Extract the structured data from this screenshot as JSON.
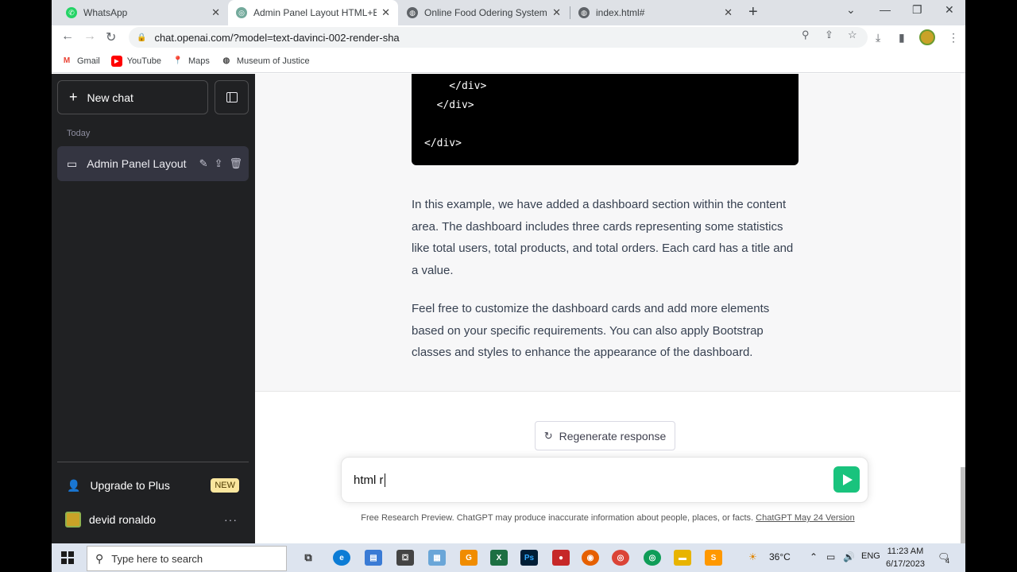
{
  "browser": {
    "tabs": [
      {
        "title": "WhatsApp",
        "icon": "whatsapp-icon",
        "color": "#25d366"
      },
      {
        "title": "Admin Panel Layout HTML+Boot",
        "icon": "openai-icon",
        "color": "#74aa9c"
      },
      {
        "title": "Online Food Odering System",
        "icon": "globe-icon",
        "color": "#5f6368"
      },
      {
        "title": "index.html#",
        "icon": "globe-icon",
        "color": "#5f6368"
      }
    ],
    "url": "chat.openai.com/?model=text-davinci-002-render-sha",
    "bookmarks": [
      {
        "label": "Gmail",
        "icon": "gmail-icon"
      },
      {
        "label": "YouTube",
        "icon": "youtube-icon"
      },
      {
        "label": "Maps",
        "icon": "maps-icon"
      },
      {
        "label": "Museum of Justice",
        "icon": "globe-icon"
      }
    ]
  },
  "sidebar": {
    "new_chat": "New chat",
    "section": "Today",
    "conversation": "Admin Panel Layout",
    "upgrade": "Upgrade to Plus",
    "badge": "NEW",
    "user": "devid ronaldo"
  },
  "main": {
    "code_lines": [
      "    </div>",
      "  </div>",
      "",
      "</div>"
    ],
    "paragraphs": [
      "In this example, we have added a dashboard section within the content area. The dashboard includes three cards representing some statistics like total users, total products, and total orders. Each card has a title and a value.",
      "Feel free to customize the dashboard cards and add more elements based on your specific requirements. You can also apply Bootstrap classes and styles to enhance the appearance of the dashboard."
    ],
    "regenerate": "Regenerate response",
    "input_value": "html r",
    "footer_text": "Free Research Preview. ChatGPT may produce inaccurate information about people, places, or facts.",
    "footer_link": "ChatGPT May 24 Version",
    "send_color": "#19c37d"
  },
  "taskbar": {
    "search_placeholder": "Type here to search",
    "temperature": "36°C",
    "language": "ENG",
    "time": "11:23 AM",
    "date": "6/17/2023",
    "notifications": "4"
  }
}
